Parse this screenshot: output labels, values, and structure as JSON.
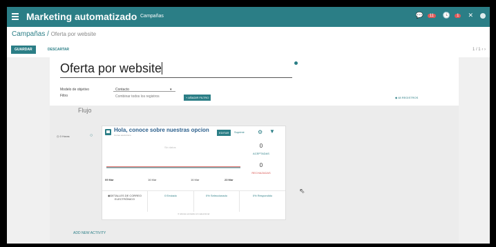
{
  "topbar": {
    "app_title": "Marketing automatizado",
    "menu_item": "Campañas",
    "chat_badge": "11",
    "activity_badge": "1"
  },
  "breadcrumb": {
    "parent": "Campañas",
    "separator": "/",
    "current": "Oferta por website"
  },
  "buttons": {
    "save": "GUARDAR",
    "discard": "DESCARTAR",
    "add_filter": "+ AÑADIR FILTRO",
    "add_activity": "ADD NEW ACTIVITY",
    "edit": "EDITAR",
    "delete": "Suprimir"
  },
  "pager": "1 / 1",
  "form": {
    "title": "Oferta por website",
    "target_model_label": "Modelo de objetivo",
    "target_model_value": "Contacto",
    "filter_label": "Filtro",
    "filter_value": "Combinar todos los registros",
    "records": "48 REGISTROS"
  },
  "flow": {
    "label": "Flujo",
    "trigger": "0 Horas"
  },
  "activity": {
    "title": "Hola, conoce sobre nuestras opcion",
    "subtitle": "Correo electrónico",
    "accepted_count": "0",
    "accepted_label": "ACEPTADAS",
    "rejected_count": "0",
    "rejected_label": "RECHAZADAS",
    "details_label": "DETALLES DE CORREO ELECTRÓNICO",
    "sent": "0 Enviado",
    "clicked": "0% Seleccionado",
    "replied": "0% Respondido",
    "footer": "0 rebotes enviados sin seleccionar"
  },
  "chart_data": {
    "type": "line",
    "title": "Sin datos",
    "x": [
      "09 Mar",
      "16 Mar",
      "16 Mar",
      "23 Mar"
    ],
    "series": [
      {
        "color": "#2b7e86",
        "values": [
          0,
          0,
          0,
          0
        ]
      },
      {
        "color": "#d9534f",
        "values": [
          0,
          0,
          0,
          0
        ]
      }
    ],
    "ylim": [
      0,
      1
    ],
    "grid": false
  },
  "colors": {
    "brand": "#2b7e86",
    "accent_red": "#d9534f"
  }
}
